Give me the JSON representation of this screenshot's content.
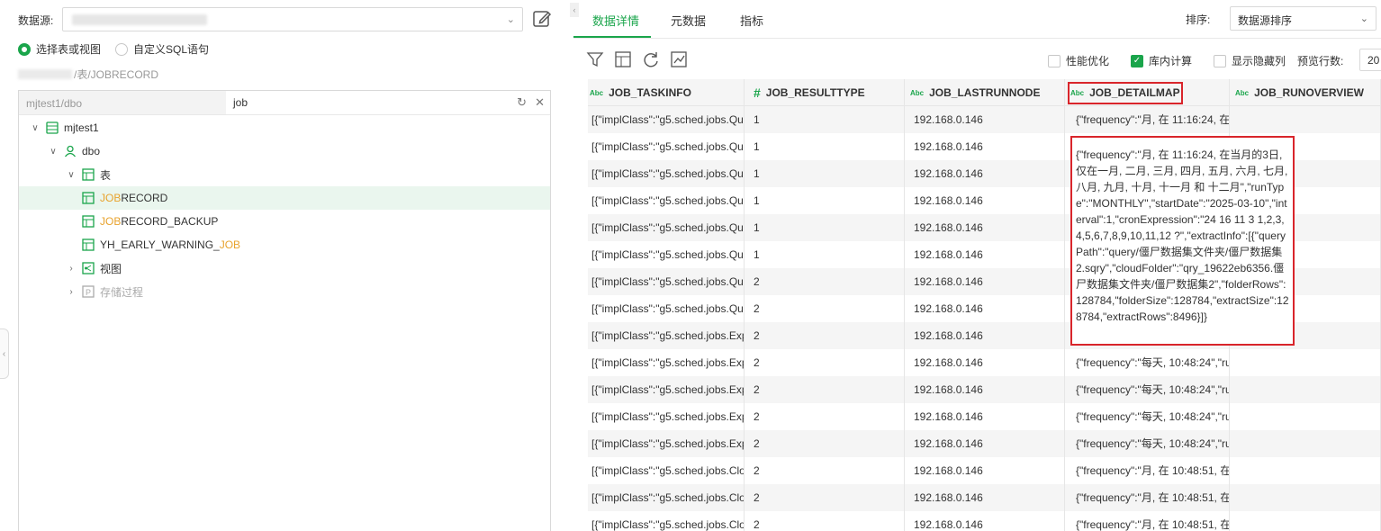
{
  "left": {
    "datasource_label": "数据源:",
    "radio_table": "选择表或视图",
    "radio_sql": "自定义SQL语句",
    "path_suffix": "/表/JOBRECORD",
    "search_scope": "mjtest1/dbo",
    "search_value": "job",
    "tree": {
      "db": "mjtest1",
      "schema": "dbo",
      "tables_folder": "表",
      "tables": [
        {
          "hl": "JOB",
          "rest": "RECORD",
          "pre": ""
        },
        {
          "hl": "JOB",
          "rest": "RECORD_BACKUP",
          "pre": ""
        },
        {
          "hl": "JOB",
          "rest": "",
          "pre": "YH_EARLY_WARNING_"
        }
      ],
      "views_folder": "视图",
      "procs_folder": "存储过程"
    }
  },
  "right": {
    "tabs": [
      "数据详情",
      "元数据",
      "指标"
    ],
    "sort_label": "排序:",
    "sort_value": "数据源排序",
    "perf_opt": "性能优化",
    "in_db_calc": "库内计算",
    "show_hidden": "显示隐藏列",
    "preview_rows_label": "预览行数:",
    "preview_rows_value": "20",
    "columns": [
      {
        "name": "JOB_TASKINFO",
        "type": "Abc"
      },
      {
        "name": "JOB_RESULTTYPE",
        "type": "#"
      },
      {
        "name": "JOB_LASTRUNNODE",
        "type": "Abc"
      },
      {
        "name": "JOB_DETAILMAP",
        "type": "Abc"
      },
      {
        "name": "JOB_RUNOVERVIEW",
        "type": "Abc"
      }
    ],
    "rows": [
      [
        "[{\"implClass\":\"g5.sched.jobs.Qu",
        "1",
        "192.168.0.146",
        "{\"frequency\":\"月, 在 11:16:24, 在"
      ],
      [
        "[{\"implClass\":\"g5.sched.jobs.Qu",
        "1",
        "192.168.0.146",
        ""
      ],
      [
        "[{\"implClass\":\"g5.sched.jobs.Qu",
        "1",
        "192.168.0.146",
        ""
      ],
      [
        "[{\"implClass\":\"g5.sched.jobs.Qu",
        "1",
        "192.168.0.146",
        ""
      ],
      [
        "[{\"implClass\":\"g5.sched.jobs.Qu",
        "1",
        "192.168.0.146",
        ""
      ],
      [
        "[{\"implClass\":\"g5.sched.jobs.Qu",
        "1",
        "192.168.0.146",
        ""
      ],
      [
        "[{\"implClass\":\"g5.sched.jobs.Qu",
        "2",
        "192.168.0.146",
        ""
      ],
      [
        "[{\"implClass\":\"g5.sched.jobs.Qu",
        "2",
        "192.168.0.146",
        ""
      ],
      [
        "[{\"implClass\":\"g5.sched.jobs.Exp",
        "2",
        "192.168.0.146",
        ""
      ],
      [
        "[{\"implClass\":\"g5.sched.jobs.Exp",
        "2",
        "192.168.0.146",
        "{\"frequency\":\"每天, 10:48:24\",\"ru"
      ],
      [
        "[{\"implClass\":\"g5.sched.jobs.Exp",
        "2",
        "192.168.0.146",
        "{\"frequency\":\"每天, 10:48:24\",\"ru"
      ],
      [
        "[{\"implClass\":\"g5.sched.jobs.Exp",
        "2",
        "192.168.0.146",
        "{\"frequency\":\"每天, 10:48:24\",\"ru"
      ],
      [
        "[{\"implClass\":\"g5.sched.jobs.Exp",
        "2",
        "192.168.0.146",
        "{\"frequency\":\"每天, 10:48:24\",\"ru"
      ],
      [
        "[{\"implClass\":\"g5.sched.jobs.Clo",
        "2",
        "192.168.0.146",
        "{\"frequency\":\"月, 在 10:48:51, 在"
      ],
      [
        "[{\"implClass\":\"g5.sched.jobs.Clo",
        "2",
        "192.168.0.146",
        "{\"frequency\":\"月, 在 10:48:51, 在"
      ],
      [
        "[{\"implClass\":\"g5.sched.jobs.Clo",
        "2",
        "192.168.0.146",
        "{\"frequency\":\"月, 在 10:48:51, 在"
      ]
    ],
    "popup_text": "{\"frequency\":\"月, 在 11:16:24, 在当月的3日, 仅在一月, 二月, 三月, 四月, 五月, 六月, 七月, 八月, 九月, 十月, 十一月 和 十二月\",\"runType\":\"MONTHLY\",\"startDate\":\"2025-03-10\",\"interval\":1,\"cronExpression\":\"24 16 11 3 1,2,3,4,5,6,7,8,9,10,11,12 ?\",\"extractInfo\":[{\"queryPath\":\"query/僵尸数据集文件夹/僵尸数据集2.sqry\",\"cloudFolder\":\"qry_19622eb6356.僵尸数据集文件夹/僵尸数据集2\",\"folderRows\":128784,\"folderSize\":128784,\"extractSize\":128784,\"extractRows\":8496}]}"
  }
}
